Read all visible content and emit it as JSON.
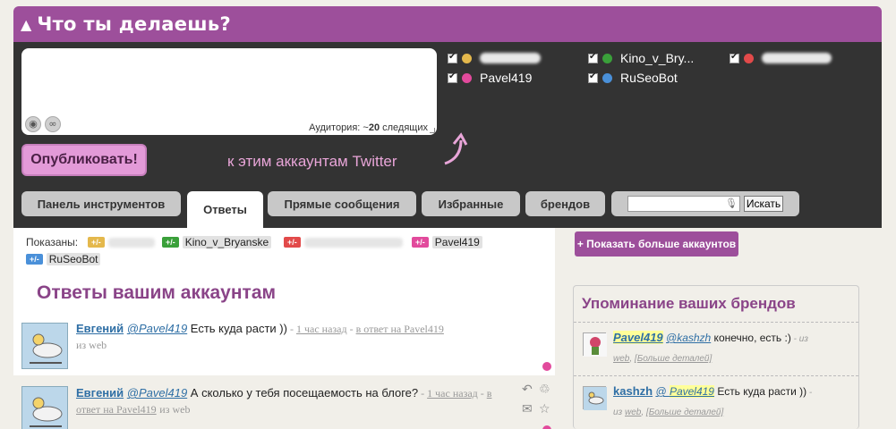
{
  "header": {
    "title": "Что ты делаешь?"
  },
  "compose": {
    "audience_label": "Аудитория: ~",
    "audience_count": "20",
    "audience_suffix": " следящих",
    "publish_label": "Опубликовать!",
    "hint": "к этим аккаунтам Twitter"
  },
  "accounts": [
    {
      "name": "",
      "color": "#e4b84c",
      "checked": true
    },
    {
      "name": "Kino_v_Bry...",
      "color": "#3aa03a",
      "checked": true
    },
    {
      "name": "",
      "color": "#e24a4a",
      "checked": true
    },
    {
      "name": "Pavel419",
      "color": "#e24a9c",
      "checked": true
    },
    {
      "name": "RuSeoBot",
      "color": "#4a90d9",
      "checked": true
    }
  ],
  "tabs": [
    {
      "label": "Панель инструментов",
      "active": false
    },
    {
      "label": "Ответы",
      "active": true
    },
    {
      "label": "Прямые сообщения",
      "active": false
    },
    {
      "label": "Избранные",
      "active": false
    },
    {
      "label": "брендов",
      "active": false
    }
  ],
  "search": {
    "button_label": "Искать",
    "value": ""
  },
  "shown": {
    "label": "Показаны:",
    "toggle": "+/-",
    "chips": [
      {
        "name": "",
        "color": "#e4b84c"
      },
      {
        "name": "Kino_v_Bryanske",
        "color": "#3aa03a"
      },
      {
        "name": "",
        "color": "#e24a4a"
      },
      {
        "name": "Pavel419",
        "color": "#e24a9c"
      },
      {
        "name": "RuSeoBot",
        "color": "#4a90d9"
      }
    ]
  },
  "more_accounts_label": "+ Показать больше аккаунтов",
  "replies": {
    "title": "Ответы вашим аккаунтам",
    "items": [
      {
        "author": "Евгений",
        "mention": "@Pavel419",
        "text": " Есть куда расти ))",
        "sep1": " - ",
        "time": "1 час назад",
        "sep2": " - ",
        "in_reply": "в ответ на Pavel419",
        "source": "из web"
      },
      {
        "author": "Евгений",
        "mention": "@Pavel419",
        "text": " А сколько у тебя посещаемость на блоге?",
        "sep1": " - ",
        "time": "1 час назад",
        "sep2": " - ",
        "in_reply": "в ответ на Pavel419",
        "source": "из web"
      }
    ]
  },
  "brands": {
    "title": "Упоминание ваших брендов",
    "items": [
      {
        "user": "Pavel419",
        "mention": "@kashzh",
        "text": " конечно, есть :)",
        "tail": " - из",
        "source": "web",
        "details": "[Больше деталей]"
      },
      {
        "user": "kashzh",
        "mention_prefix": "@ ",
        "mention": "Pavel419",
        "text": " Есть куда расти ))",
        "tail": " -",
        "source_prefix": "из ",
        "source": "web",
        "details": "[Больше деталей]"
      }
    ]
  }
}
